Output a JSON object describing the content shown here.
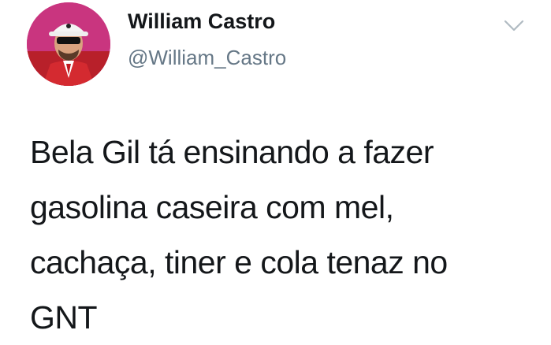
{
  "tweet": {
    "author": {
      "display_name": "William Castro",
      "handle": "@William_Castro",
      "avatar_icon": "profile-photo"
    },
    "menu_icon": "chevron-down-icon",
    "text_lines": [
      "Bela Gil tá ensinando a fazer",
      "gasolina caseira com mel,",
      "cachaça, tiner e cola tenaz no",
      "GNT"
    ]
  },
  "colors": {
    "text": "#14171a",
    "secondary": "#657786",
    "background": "#ffffff"
  }
}
